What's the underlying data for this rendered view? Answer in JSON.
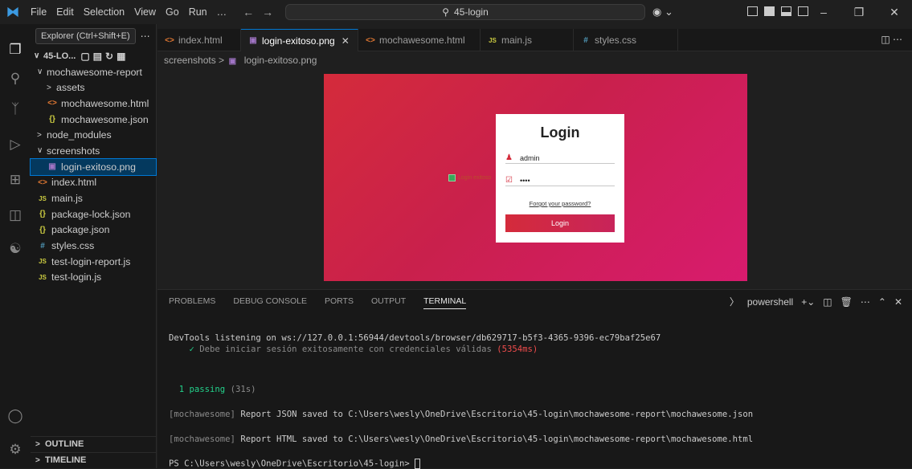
{
  "titlebar": {
    "menu": [
      "File",
      "Edit",
      "Selection",
      "View",
      "Go",
      "Run",
      "…"
    ],
    "search": "45-login"
  },
  "sidebar": {
    "tooltip": "Explorer (Ctrl+Shift+E)",
    "root": "45-LO...",
    "tree": [
      {
        "label": "mochawesome-report",
        "kind": "folder-open",
        "depth": 1
      },
      {
        "label": "assets",
        "kind": "folder",
        "depth": 2
      },
      {
        "label": "mochawesome.html",
        "kind": "html",
        "depth": 2
      },
      {
        "label": "mochawesome.json",
        "kind": "json",
        "depth": 2
      },
      {
        "label": "node_modules",
        "kind": "folder",
        "depth": 1
      },
      {
        "label": "screenshots",
        "kind": "folder-open",
        "depth": 1
      },
      {
        "label": "login-exitoso.png",
        "kind": "png",
        "depth": 2,
        "selected": true
      },
      {
        "label": "index.html",
        "kind": "html",
        "depth": 1
      },
      {
        "label": "main.js",
        "kind": "js",
        "depth": 1
      },
      {
        "label": "package-lock.json",
        "kind": "json",
        "depth": 1
      },
      {
        "label": "package.json",
        "kind": "json",
        "depth": 1
      },
      {
        "label": "styles.css",
        "kind": "css",
        "depth": 1
      },
      {
        "label": "test-login-report.js",
        "kind": "js",
        "depth": 1
      },
      {
        "label": "test-login.js",
        "kind": "js",
        "depth": 1
      }
    ],
    "outline": "OUTLINE",
    "timeline": "TIMELINE"
  },
  "tabs": [
    {
      "label": "index.html",
      "kind": "html"
    },
    {
      "label": "login-exitoso.png",
      "kind": "png",
      "active": true
    },
    {
      "label": "mochawesome.html",
      "kind": "html"
    },
    {
      "label": "main.js",
      "kind": "js"
    },
    {
      "label": "styles.css",
      "kind": "css"
    }
  ],
  "breadcrumb": {
    "folder": "screenshots",
    "file": "login-exitoso.png"
  },
  "preview": {
    "title": "Login",
    "username": "admin",
    "password": "••••",
    "forgot": "Forgot your password?",
    "button": "Login",
    "remember_text": "Login exitoso"
  },
  "panel": {
    "tabs": [
      "PROBLEMS",
      "DEBUG CONSOLE",
      "PORTS",
      "OUTPUT",
      "TERMINAL"
    ],
    "active_tab": "TERMINAL",
    "shell": "powershell"
  },
  "terminal": {
    "devtools": "DevTools listening on ws://127.0.0.1:56944/devtools/browser/db629717-b5f3-4365-9396-ec79baf25e67",
    "check": "✓",
    "test_name": "Debe iniciar sesión exitosamente con credenciales válidas",
    "test_time": "(5354ms)",
    "passing": "1 passing",
    "passing_time": "(31s)",
    "mochawesome_tag": "[mochawesome]",
    "json_saved": "Report JSON saved to C:\\Users\\wesly\\OneDrive\\Escritorio\\45-login\\mochawesome-report\\mochawesome.json",
    "html_saved": "Report HTML saved to C:\\Users\\wesly\\OneDrive\\Escritorio\\45-login\\mochawesome-report\\mochawesome.html",
    "prompt": "PS C:\\Users\\wesly\\OneDrive\\Escritorio\\45-login> "
  },
  "colors": {
    "accent": "#0078d4",
    "login_gradient_start": "#d42b3b",
    "login_gradient_end": "#d81b6e",
    "pass_green": "#23d18b",
    "time_red": "#f14c4c"
  }
}
